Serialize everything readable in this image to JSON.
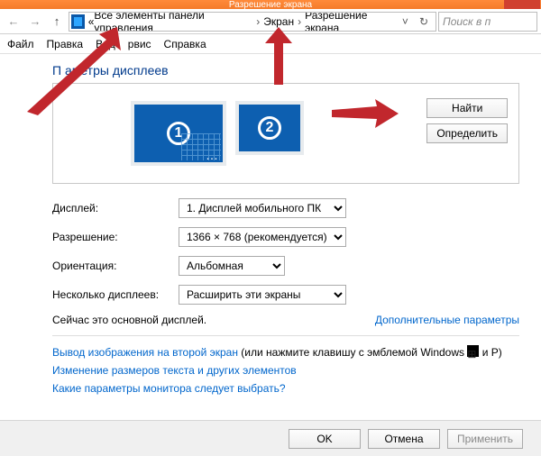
{
  "window": {
    "title": "Разрешение экрана"
  },
  "breadcrumb": {
    "overflow": "«",
    "item1": "Все элементы панели управления",
    "item2": "Экран",
    "item3": "Разрешение экрана"
  },
  "search": {
    "placeholder": "Поиск в п"
  },
  "menu": {
    "file": "Файл",
    "edit": "Правка",
    "view": "Вид",
    "service": "рвис",
    "help": "Справка"
  },
  "page": {
    "heading": "П      аметры дисплеев",
    "monitors": {
      "m1": "1",
      "m2": "2"
    },
    "buttons": {
      "find": "Найти",
      "identify": "Определить"
    },
    "fields": {
      "display_label": "Дисплей:",
      "display_value": "1. Дисплей мобильного ПК",
      "resolution_label": "Разрешение:",
      "resolution_value": "1366 × 768 (рекомендуется)",
      "orientation_label": "Ориентация:",
      "orientation_value": "Альбомная",
      "multi_label": "Несколько дисплеев:",
      "multi_value": "Расширить эти экраны"
    },
    "primary_note": "Сейчас это основной дисплей.",
    "adv_link": "Дополнительные параметры",
    "proj_prefix": "Вывод изображения на второй экран",
    "proj_suffix": " (или нажмите клавишу с эмблемой Windows ",
    "proj_tail": " и P)",
    "textsize_link": "Изменение размеров текста и других элементов",
    "which_link": "Какие параметры монитора следует выбрать?"
  },
  "footer": {
    "ok": "OK",
    "cancel": "Отмена",
    "apply": "Применить"
  }
}
